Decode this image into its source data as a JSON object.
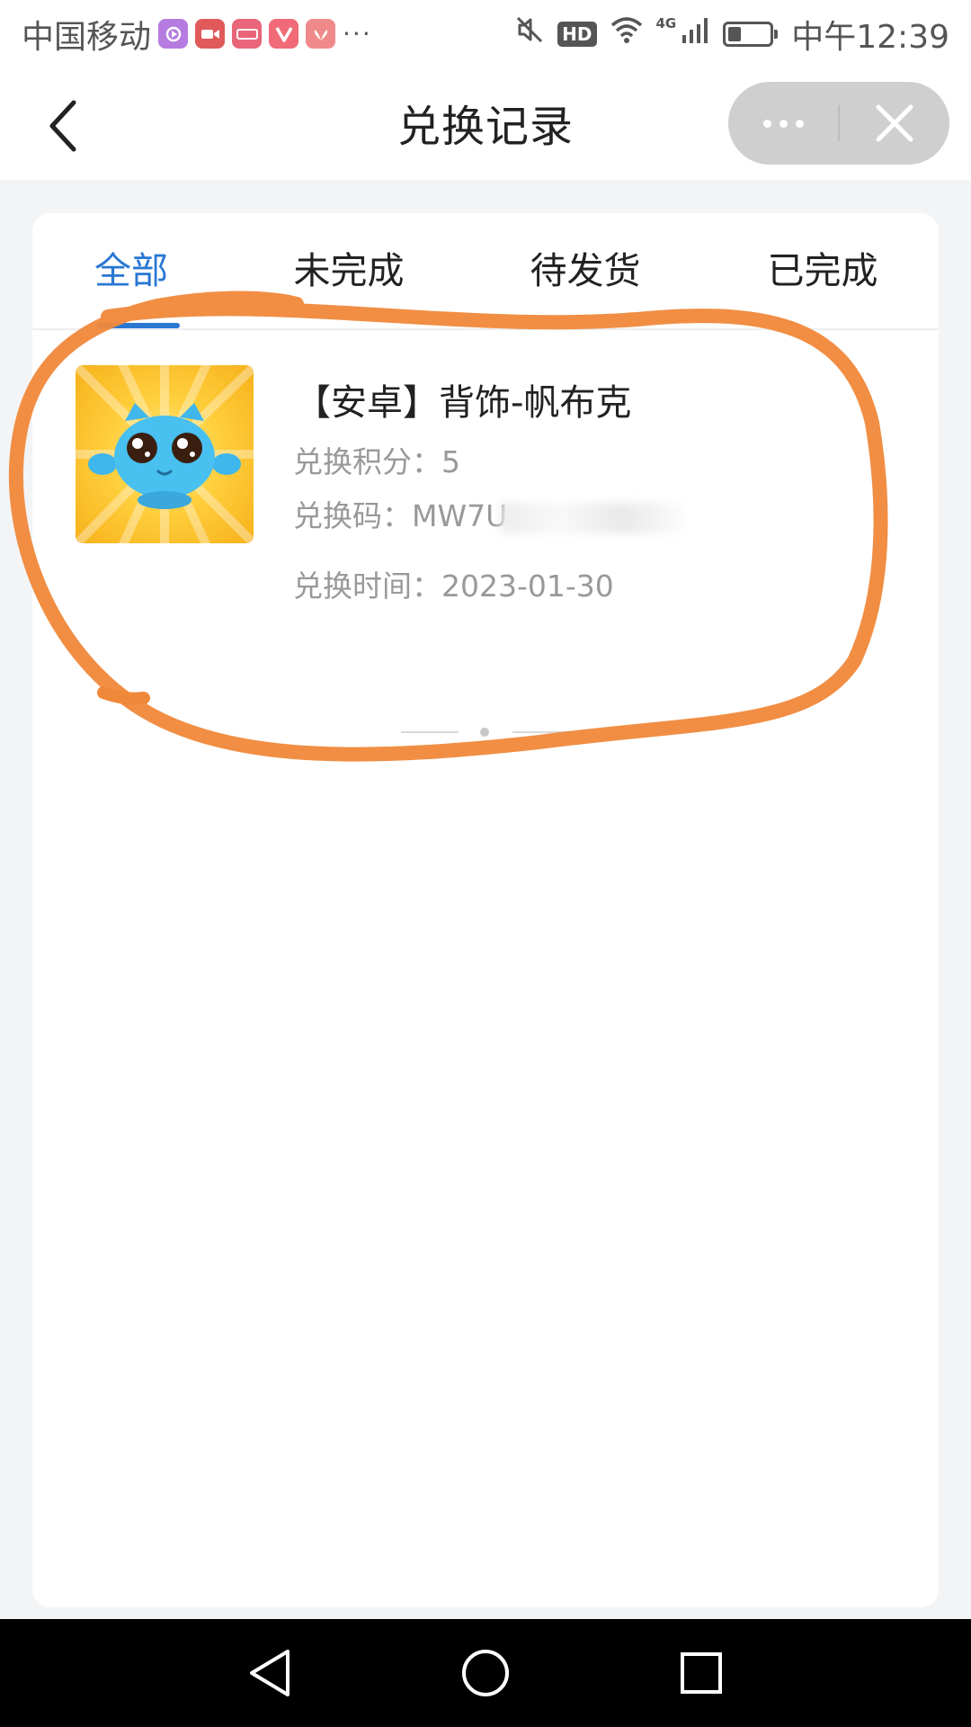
{
  "status_bar": {
    "carrier": "中国移动",
    "apps": [
      {
        "name": "app-purple-icon",
        "color": "#b57be0"
      },
      {
        "name": "app-camera-icon",
        "color": "#e05a5a"
      },
      {
        "name": "app-video-icon",
        "color": "#e8657a"
      },
      {
        "name": "app-v-icon",
        "color": "#f06a78"
      },
      {
        "name": "app-huawei-icon",
        "color": "#f08a8a"
      }
    ],
    "more": "···",
    "network": "4G",
    "hd": "HD",
    "time": "中午12:39"
  },
  "header": {
    "title": "兑换记录",
    "back_icon": "chevron-left-icon",
    "more_icon": "more-dots-icon",
    "close_icon": "close-icon"
  },
  "tabs": [
    {
      "label": "全部",
      "active": true
    },
    {
      "label": "未完成",
      "active": false
    },
    {
      "label": "待发货",
      "active": false
    },
    {
      "label": "已完成",
      "active": false
    }
  ],
  "records": [
    {
      "title": "【安卓】背饰-帆布克",
      "points_label": "兑换积分：",
      "points_value": "5",
      "code_label": "兑换码：",
      "code_value": "MW7U",
      "time_label": "兑换时间：",
      "time_value": "2023-01-30"
    }
  ],
  "colors": {
    "accent": "#2a77d4",
    "annotation": "#f0883a",
    "capsule": "#cfcfcf"
  },
  "nav": {
    "back_icon": "nav-back-triangle-icon",
    "home_icon": "nav-home-circle-icon",
    "recent_icon": "nav-recent-square-icon"
  }
}
